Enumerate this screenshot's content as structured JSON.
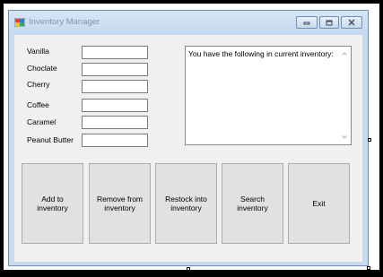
{
  "window": {
    "title": "Inventory Manager"
  },
  "form": {
    "fields": [
      {
        "label": "Vanilla",
        "value": ""
      },
      {
        "label": "Choclate",
        "value": ""
      },
      {
        "label": "Cherry",
        "value": ""
      },
      {
        "label": "Coffee",
        "value": ""
      },
      {
        "label": "Caramel",
        "value": ""
      },
      {
        "label": "Peanut Butter",
        "value": ""
      }
    ],
    "output_text": "You have the following in current inventory:"
  },
  "buttons": {
    "add": "Add to inventory",
    "remove": "Remove from inventory",
    "restock": "Restock into inventory",
    "search": "Search inventory",
    "exit": "Exit"
  },
  "icons": {
    "app": "app-icon",
    "minimize": "minimize-icon",
    "maximize": "maximize-icon",
    "close": "close-icon",
    "scroll_up": "chevron-up-icon",
    "scroll_down": "chevron-down-icon"
  },
  "colors": {
    "titlebar": "#c9dbef",
    "client_background": "#f0f0f0",
    "button_face": "#e1e1e1"
  }
}
